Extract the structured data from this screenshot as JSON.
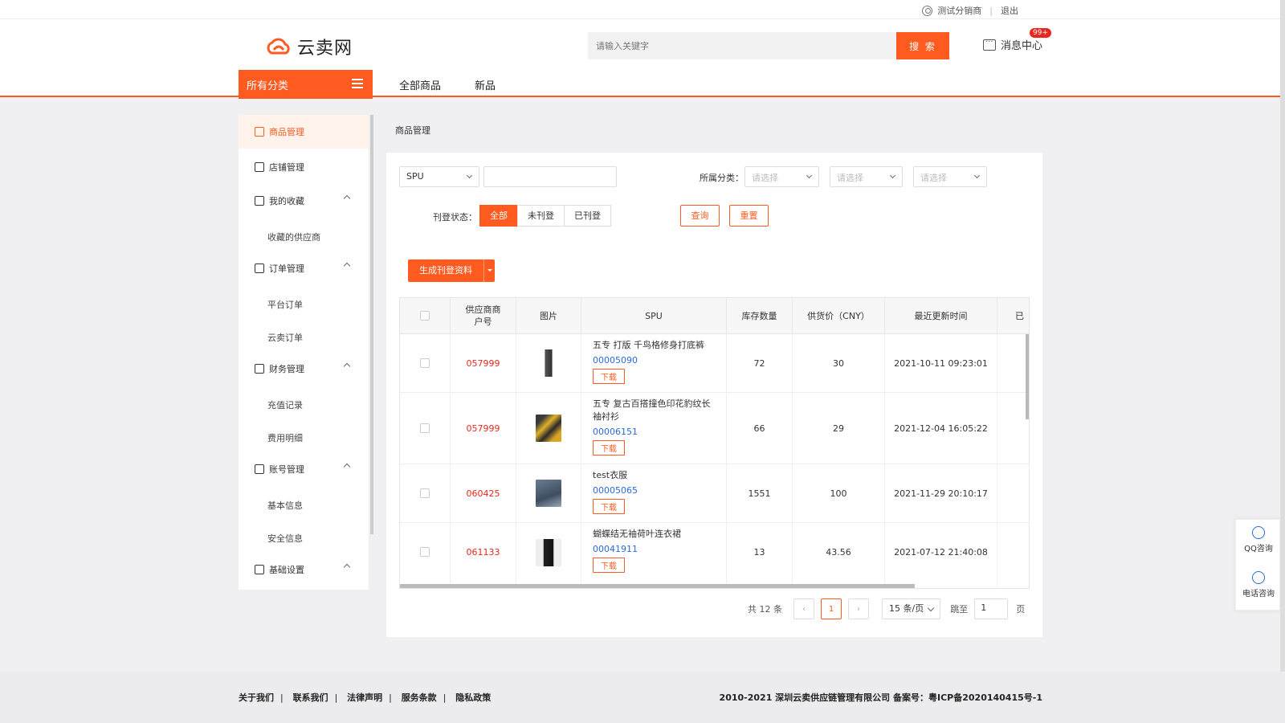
{
  "topbar": {
    "user": "测试分销商",
    "logout": "退出"
  },
  "header": {
    "logo_text": "云卖网",
    "search_placeholder": "请输入关键字",
    "search_button": "搜 索",
    "message_center": "消息中心",
    "message_badge": "99+",
    "category_button": "所有分类",
    "nav": [
      "全部商品",
      "新品"
    ]
  },
  "sidebar": {
    "items": [
      {
        "label": "商品管理",
        "icon": "goods-icon",
        "active": true
      },
      {
        "label": "店铺管理",
        "icon": "shop-icon"
      },
      {
        "label": "我的收藏",
        "icon": "star-icon"
      },
      {
        "label": "订单管理",
        "icon": "order-icon"
      },
      {
        "label": "财务管理",
        "icon": "finance-icon"
      },
      {
        "label": "账号管理",
        "icon": "account-icon"
      },
      {
        "label": "基础设置",
        "icon": "settings-icon"
      }
    ],
    "subs": {
      "favorites": [
        "收藏的供应商"
      ],
      "orders": [
        "平台订单",
        "云卖订单"
      ],
      "finance": [
        "充值记录",
        "费用明细"
      ],
      "account": [
        "基本信息",
        "安全信息"
      ]
    }
  },
  "breadcrumb": "商品管理",
  "filters": {
    "field_select": "SPU",
    "category_label": "所属分类：",
    "category_placeholder": "请选择",
    "status_label": "刊登状态：",
    "status_options": [
      "全部",
      "未刊登",
      "已刊登"
    ],
    "query": "查询",
    "reset": "重置"
  },
  "generate_button": "生成刊登资料",
  "table": {
    "headers": [
      "供应商商户号",
      "图片",
      "SPU",
      "库存数量",
      "供货价（CNY）",
      "最近更新时间",
      "已"
    ],
    "rows": [
      {
        "supplier": "057999",
        "name": "五专 打版 千鸟格修身打底裤",
        "spu": "00005090",
        "stock": "72",
        "price": "30",
        "updated": "2021-10-11 09:23:01"
      },
      {
        "supplier": "057999",
        "name": "五专 复古百搭撞色印花豹纹长袖衬衫",
        "spu": "00006151",
        "stock": "66",
        "price": "29",
        "updated": "2021-12-04 16:05:22"
      },
      {
        "supplier": "060425",
        "name": "test衣服",
        "spu": "00005065",
        "stock": "1551",
        "price": "100",
        "updated": "2021-11-29 20:10:17"
      },
      {
        "supplier": "061133",
        "name": "蝴蝶结无袖荷叶连衣裙",
        "spu": "00041911",
        "stock": "13",
        "price": "43.56",
        "updated": "2021-07-12 21:40:08"
      }
    ],
    "download": "下载"
  },
  "pagination": {
    "total": "共 12 条",
    "current": "1",
    "page_size": "15 条/页",
    "jump_label": "跳至",
    "jump_value": "1",
    "unit": "页"
  },
  "float_service": {
    "qq": "QQ咨询",
    "phone": "电话咨询"
  },
  "footer": {
    "links": [
      "关于我们",
      "联系我们",
      "法律声明",
      "服务条款",
      "隐私政策"
    ],
    "copyright": "2010-2021 深圳云卖供应链管理有限公司 备案号：粤ICP备2020140415号-1"
  },
  "colors": {
    "accent": "#ff5a1f",
    "link": "#2a6ad8",
    "supplier": "#e8281e"
  }
}
